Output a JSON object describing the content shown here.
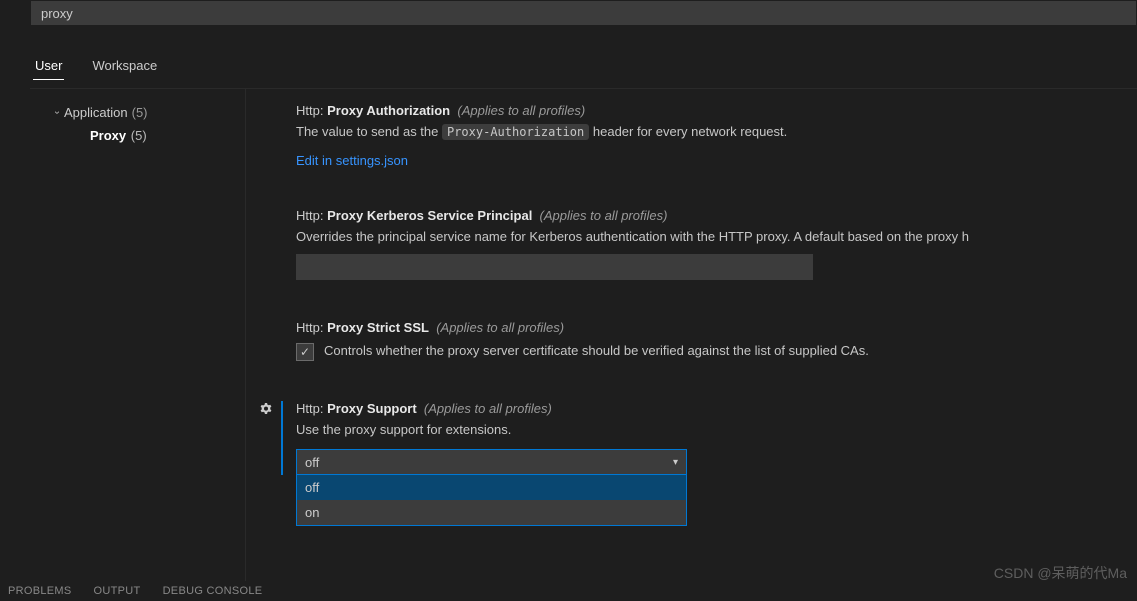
{
  "search": {
    "value": "proxy"
  },
  "tabs": {
    "user": "User",
    "workspace": "Workspace"
  },
  "sidebar": {
    "group": {
      "label": "Application",
      "count": "(5)"
    },
    "child": {
      "label": "Proxy",
      "count": "(5)"
    }
  },
  "settings": {
    "proxyAuth": {
      "prefix": "Http:",
      "name": "Proxy Authorization",
      "scope": "(Applies to all profiles)",
      "desc_before": "The value to send as the ",
      "code": "Proxy-Authorization",
      "desc_after": " header for every network request.",
      "link": "Edit in settings.json"
    },
    "kerberos": {
      "prefix": "Http:",
      "name": "Proxy Kerberos Service Principal",
      "scope": "(Applies to all profiles)",
      "desc": "Overrides the principal service name for Kerberos authentication with the HTTP proxy. A default based on the proxy h"
    },
    "strictSsl": {
      "prefix": "Http:",
      "name": "Proxy Strict SSL",
      "scope": "(Applies to all profiles)",
      "desc": "Controls whether the proxy server certificate should be verified against the list of supplied CAs."
    },
    "proxySupport": {
      "prefix": "Http:",
      "name": "Proxy Support",
      "scope": "(Applies to all profiles)",
      "desc": "Use the proxy support for extensions.",
      "value": "off",
      "options": [
        "off",
        "on"
      ]
    }
  },
  "panel": {
    "problems": "PROBLEMS",
    "output": "OUTPUT",
    "debug": "DEBUG CONSOLE"
  },
  "watermark": "CSDN @呆萌的代Ma"
}
